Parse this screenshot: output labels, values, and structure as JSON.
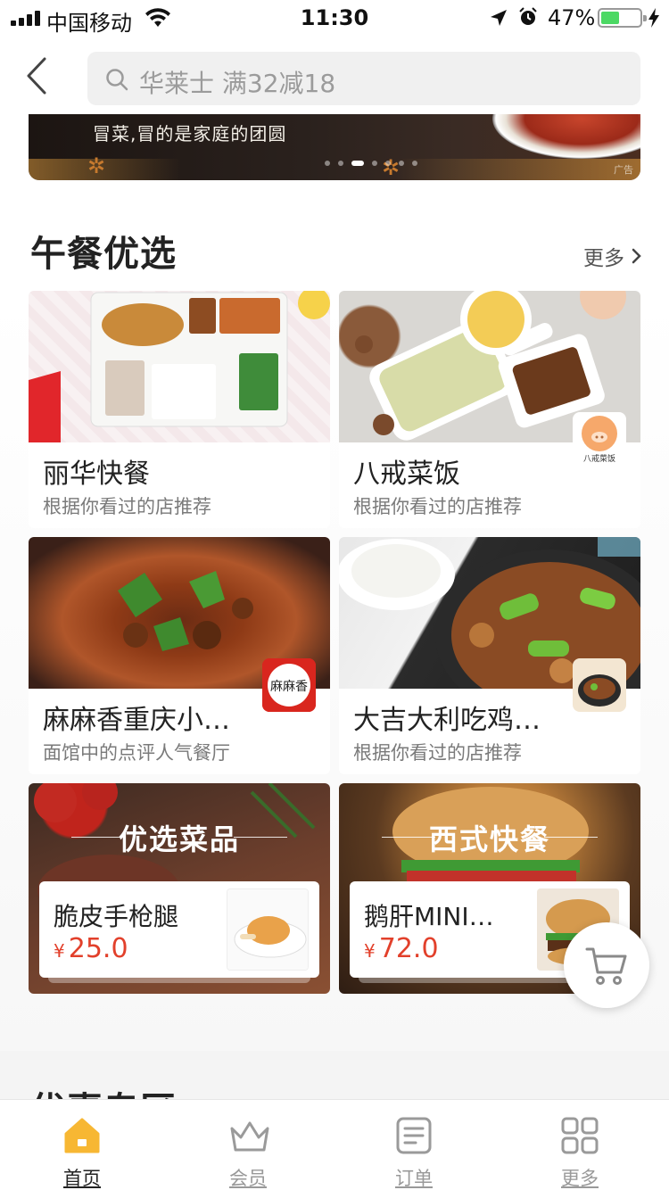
{
  "status_bar": {
    "carrier": "中国移动",
    "time": "11:30",
    "battery_percent": "47%",
    "battery_level": 0.47,
    "icons": [
      "signal-icon",
      "wifi-icon",
      "location-arrow-icon",
      "alarm-icon",
      "battery-icon",
      "charging-bolt-icon"
    ]
  },
  "header": {
    "back_icon": "chevron-left-icon",
    "search_placeholder": "华莱士 满32减18"
  },
  "banner": {
    "text": "冒菜,冒的是家庭的团圆",
    "ad_label": "广告",
    "page_count": 7,
    "active_page": 2
  },
  "section": {
    "title": "午餐优选",
    "more_label": "更多"
  },
  "restaurants": [
    {
      "name": "丽华快餐",
      "subtitle": "根据你看过的店推荐"
    },
    {
      "name": "八戒菜饭",
      "subtitle": "根据你看过的店推荐",
      "badge_text": "八戒菜饭"
    },
    {
      "name": "麻麻香重庆小…",
      "subtitle": "面馆中的点评人气餐厅",
      "badge_text": "麻麻香"
    },
    {
      "name": "大吉大利吃鸡…",
      "subtitle": "根据你看过的店推荐"
    }
  ],
  "promos": [
    {
      "title": "优选菜品",
      "item_name": "脆皮手枪腿",
      "currency": "¥",
      "price": "25.0"
    },
    {
      "title": "西式快餐",
      "item_name": "鹅肝MINI…",
      "currency": "¥",
      "price": "72.0"
    }
  ],
  "next_section_title": "优惠专区",
  "tabs": [
    {
      "label": "首页",
      "icon": "home-icon",
      "active": true
    },
    {
      "label": "会员",
      "icon": "crown-icon",
      "active": false
    },
    {
      "label": "订单",
      "icon": "order-icon",
      "active": false
    },
    {
      "label": "更多",
      "icon": "grid-icon",
      "active": false
    }
  ],
  "colors": {
    "accent_orange": "#f7b733",
    "price_red": "#e2402b",
    "battery_green": "#4cd964"
  }
}
